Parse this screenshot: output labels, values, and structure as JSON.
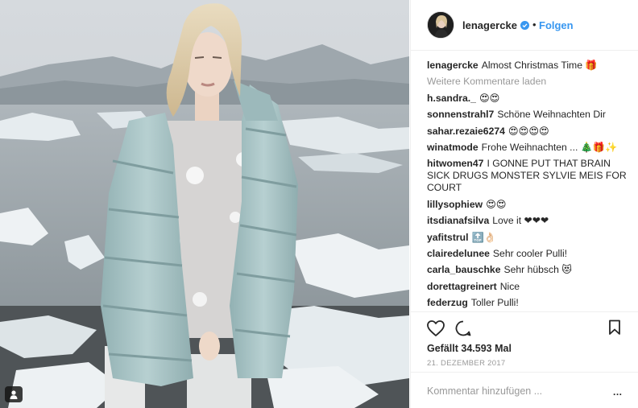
{
  "post": {
    "author": "lenagercke",
    "follow_label": "Folgen",
    "separator": "•",
    "verified_icon": "verified-badge-icon",
    "caption": "Almost Christmas Time 🎁",
    "load_more": "Weitere Kommentare laden",
    "comments": [
      {
        "user": "h.sandra._",
        "text": "😍😍"
      },
      {
        "user": "sonnenstrahl7",
        "text": "Schöne Weihnachten Dir"
      },
      {
        "user": "sahar.rezaie6274",
        "text": "😍😍😍😍"
      },
      {
        "user": "winatmode",
        "text": "Frohe Weihnachten ... 🎄🎁✨"
      },
      {
        "user": "hitwomen47",
        "text": "I GONNE PUT THAT BRAIN SICK DRUGS MONSTER SYLVIE MEIS FOR COURT"
      },
      {
        "user": "lillysophiew",
        "text": "😍😍"
      },
      {
        "user": "itsdianafsilva",
        "text": "Love it ❤❤❤"
      },
      {
        "user": "yafitstrul",
        "text": "🔝👌🏻"
      },
      {
        "user": "clairedelunee",
        "text": "Sehr cooler Pulli!"
      },
      {
        "user": "carla_bauschke",
        "text": "Sehr hübsch 😻"
      },
      {
        "user": "dorettagreinert",
        "text": "Nice"
      },
      {
        "user": "federzug",
        "text": "Toller Pulli!"
      }
    ],
    "likes": "Gefällt 34.593 Mal",
    "date": "21. DEZEMBER 2017",
    "comment_placeholder": "Kommentar hinzufügen ...",
    "more_label": "..."
  },
  "colors": {
    "link_blue": "#3897f0",
    "text": "#262626",
    "muted": "#999999",
    "border": "#efefef",
    "jacket": "#a9c5c6",
    "sweater": "#dcdad9"
  }
}
